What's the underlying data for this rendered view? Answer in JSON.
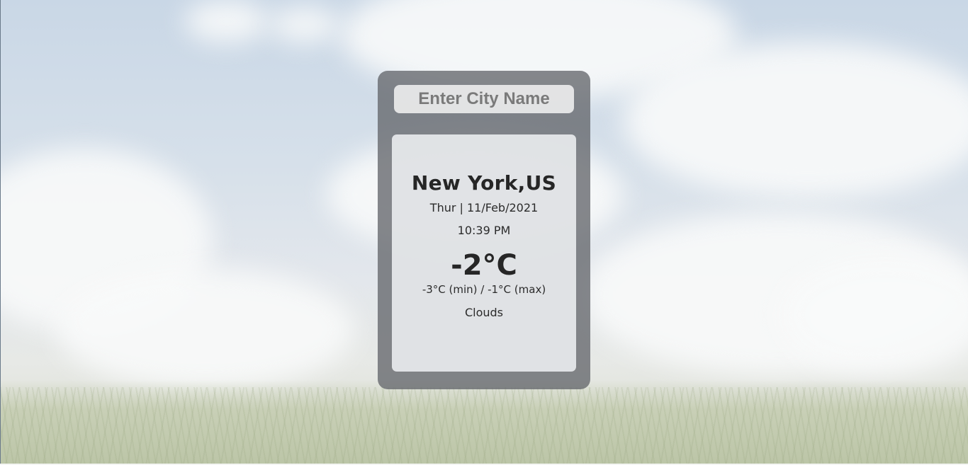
{
  "search": {
    "placeholder": "Enter City Name"
  },
  "weather": {
    "location": "New York,US",
    "date": "Thur | 11/Feb/2021",
    "time": "10:39 PM",
    "temperature": "-2°C",
    "min_max": "-3°C (min) / -1°C (max)",
    "condition": "Clouds"
  },
  "colors": {
    "card_background": "#64676c",
    "panel_background": "#f0f2f4",
    "text": "#262626"
  }
}
